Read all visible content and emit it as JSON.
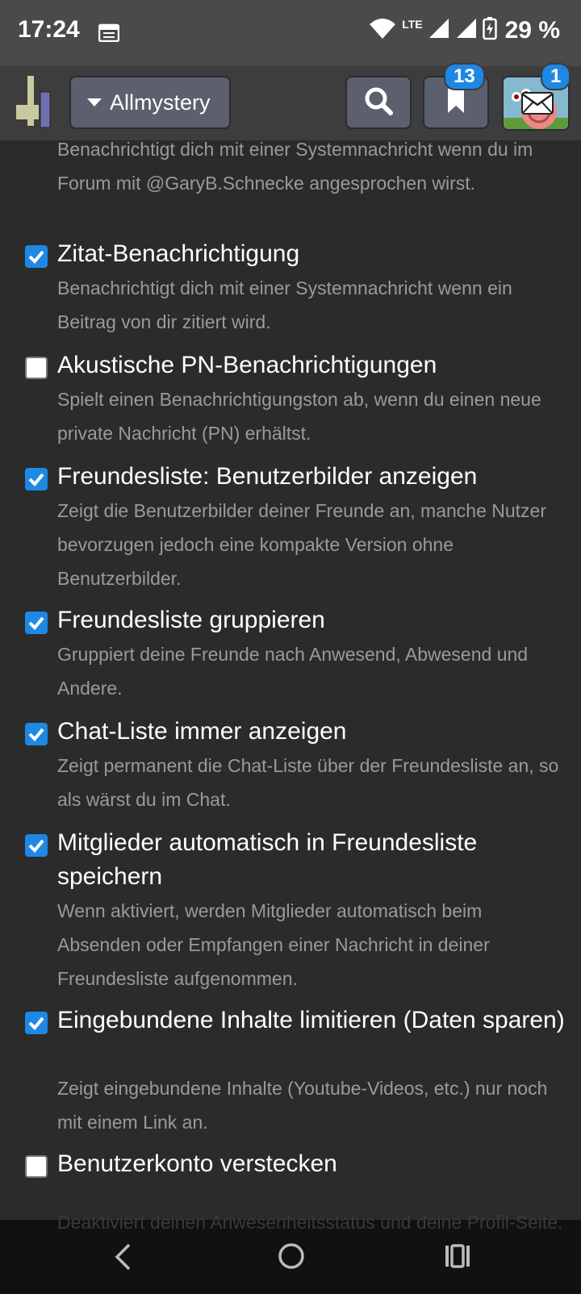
{
  "status_bar": {
    "time": "17:24",
    "network": "LTE",
    "battery": "29 %"
  },
  "header": {
    "forum_label": "Allmystery",
    "bookmark_badge": "13",
    "message_badge": "1"
  },
  "settings": {
    "partial_description": "Benachrichtigt dich mit einer Systemnachricht wenn du im Forum mit @GaryB.Schnecke angesprochen wirst.",
    "items": [
      {
        "title": "Zitat-Benachrichtigung",
        "description": "Benachrichtigt dich mit einer Systemnachricht wenn ein Beitrag von dir zitiert wird.",
        "checked": true
      },
      {
        "title": "Akustische PN-Benachrichtigungen",
        "description": "Spielt einen Benachrichtigungston ab, wenn du einen neue private Nachricht (PN) erhältst.",
        "checked": false
      },
      {
        "title": "Freundesliste: Benutzerbilder anzeigen",
        "description": "Zeigt die Benutzerbilder deiner Freunde an, manche Nutzer bevorzugen jedoch eine kompakte Version ohne Benutzerbilder.",
        "checked": true
      },
      {
        "title": "Freundesliste gruppieren",
        "description": "Gruppiert deine Freunde nach Anwesend, Abwesend und Andere.",
        "checked": true
      },
      {
        "title": "Chat-Liste immer anzeigen",
        "description": "Zeigt permanent die Chat-Liste über der Freundesliste an, so als wärst du im Chat.",
        "checked": true
      },
      {
        "title": "Mitglieder automatisch in Freundesliste speichern",
        "description": "Wenn aktiviert, werden Mitglieder automatisch beim Absenden oder Empfangen einer Nachricht in deiner Freundesliste aufgenommen.",
        "checked": true
      },
      {
        "title": "Eingebundene Inhalte limitieren (Daten sparen)",
        "description": "Zeigt eingebundene Inhalte (Youtube-Videos, etc.) nur noch mit einem Link an.",
        "checked": true
      },
      {
        "title": "Benutzerkonto verstecken",
        "description": "Deaktiviert deinen Anwesenheitsstatus und deine Profil-Seite.",
        "checked": false
      }
    ]
  },
  "colors": {
    "accent": "#1e88e5",
    "background": "#2b2b2b",
    "header": "#3d3d3d",
    "muted_text": "#9a9a9a"
  }
}
